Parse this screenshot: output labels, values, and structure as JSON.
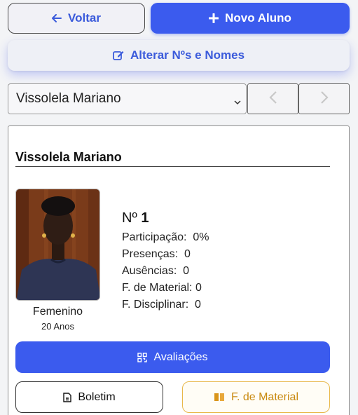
{
  "toolbar": {
    "back_label": "Voltar",
    "new_label": "Novo Aluno",
    "edit_label": "Alterar Nºs e Nomes"
  },
  "student_select": {
    "selected": "Vissolela Mariano"
  },
  "student": {
    "name": "Vissolela Mariano",
    "number_prefix": "Nº",
    "number": "1",
    "gender": "Femenino",
    "age": "20 Anos",
    "stats": [
      {
        "label": "Participação:",
        "value": "0%"
      },
      {
        "label": "Presenças:",
        "value": "0"
      },
      {
        "label": "Ausências:",
        "value": "0"
      },
      {
        "label": "F. de Material:",
        "value": "0"
      },
      {
        "label": "F. Disciplinar:",
        "value": "0"
      }
    ]
  },
  "actions": {
    "evaluations_label": "Avaliações",
    "report_label": "Boletim",
    "material_label": "F. de Material"
  },
  "colors": {
    "primary": "#3b5bee",
    "accent_orange": "#c98a10",
    "outline": "#4a4a4a"
  },
  "icons": {
    "back": "arrow-left-icon",
    "new": "plus-icon",
    "edit": "edit-icon",
    "prev": "chevron-left-icon",
    "next": "chevron-right-icon",
    "evaluations": "qr-grid-icon",
    "report": "document-icon",
    "material": "book-icon"
  }
}
